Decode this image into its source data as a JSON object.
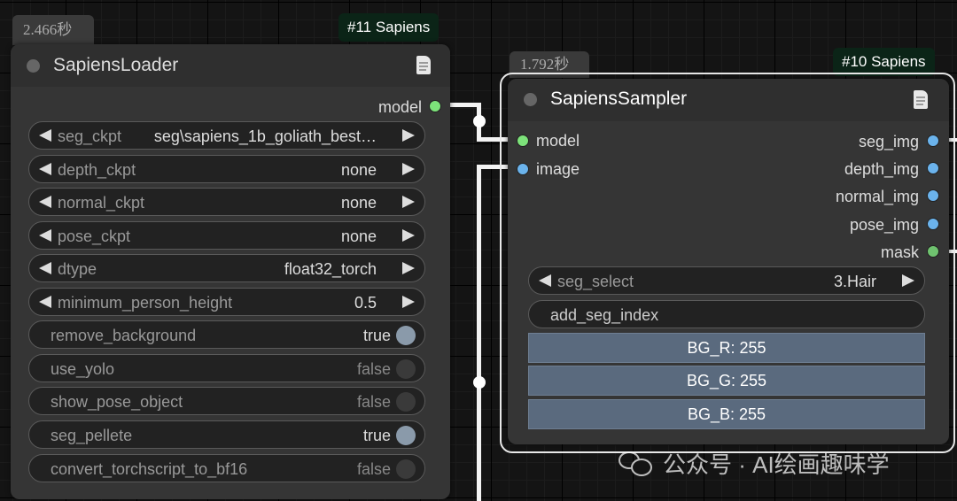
{
  "loader": {
    "timing": "2.466秒",
    "badge": "#11 Sapiens",
    "title": "SapiensLoader",
    "output_label": "model",
    "widgets": [
      {
        "name": "seg_ckpt",
        "value": "seg\\sapiens_1b_goliath_best…"
      },
      {
        "name": "depth_ckpt",
        "value": "none"
      },
      {
        "name": "normal_ckpt",
        "value": "none"
      },
      {
        "name": "pose_ckpt",
        "value": "none"
      },
      {
        "name": "dtype",
        "value": "float32_torch"
      },
      {
        "name": "minimum_person_height",
        "value": "0.5"
      }
    ],
    "toggles": [
      {
        "name": "remove_background",
        "value": "true"
      },
      {
        "name": "use_yolo",
        "value": "false"
      },
      {
        "name": "show_pose_object",
        "value": "false"
      },
      {
        "name": "seg_pellete",
        "value": "true"
      },
      {
        "name": "convert_torchscript_to_bf16",
        "value": "false"
      }
    ]
  },
  "sampler": {
    "timing": "1.792秒",
    "badge": "#10 Sapiens",
    "title": "SapiensSampler",
    "inputs": [
      "model",
      "image"
    ],
    "outputs": [
      "seg_img",
      "depth_img",
      "normal_img",
      "pose_img",
      "mask"
    ],
    "seg_select": {
      "name": "seg_select",
      "value": "3.Hair"
    },
    "add_seg_index": "add_seg_index",
    "bg": [
      "BG_R: 255",
      "BG_G: 255",
      "BG_B: 255"
    ]
  },
  "watermark": "公众号 · AI绘画趣味学",
  "colors": {
    "model_slot": "#7de27a",
    "image_slot": "#6bb3ec",
    "mask_slot": "#6fc26f",
    "badge_bg": "#0b2417"
  }
}
